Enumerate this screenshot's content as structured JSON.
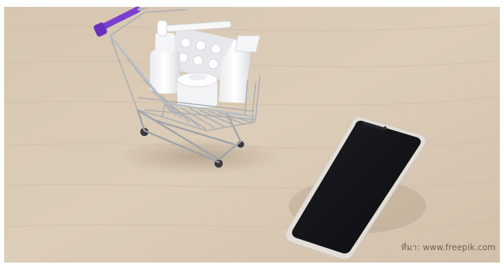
{
  "photo": {
    "credit": "ที่มา:  www.freepik.com"
  },
  "colors": {
    "table": "#d8c8b4",
    "cart_handle": "#7b3fd1",
    "phone_screen": "#15161a",
    "phone_frame": "#e3dfd8"
  },
  "icons": [
    "shopping-cart-icon",
    "smartphone-icon"
  ]
}
